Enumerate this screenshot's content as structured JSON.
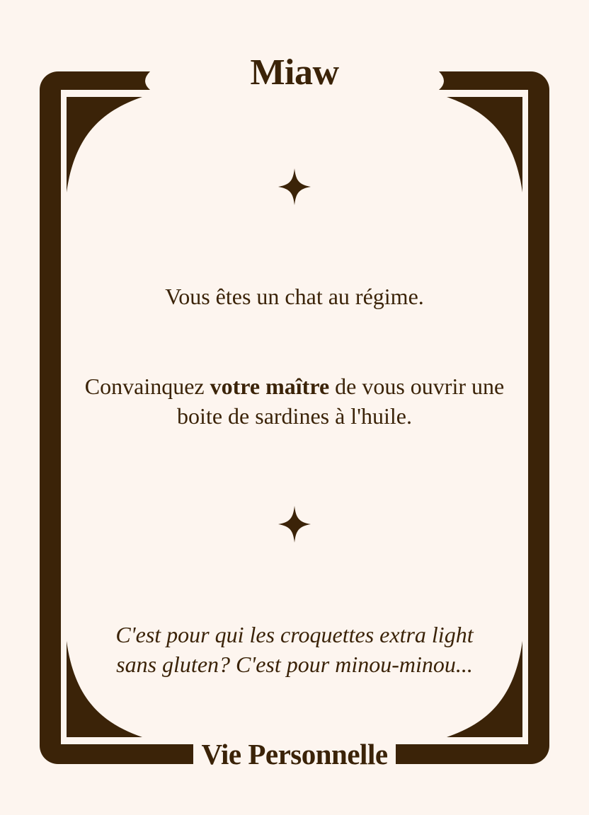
{
  "card": {
    "title": "Miaw",
    "category": "Vie Personnelle",
    "statement": "Vous êtes un chat au régime.",
    "task": {
      "before": "Convainquez ",
      "emphasis": "votre maître",
      "after": " de vous ouvrir une boite de sardines à l'huile."
    },
    "quote": "C'est pour qui les croquettes extra light sans gluten? C'est pour minou-minou..."
  },
  "ornaments": {
    "top_star": "four-point-star-icon",
    "bottom_star": "four-point-star-icon"
  },
  "colors": {
    "background": "#fdf5ef",
    "ink": "#3b2308"
  }
}
